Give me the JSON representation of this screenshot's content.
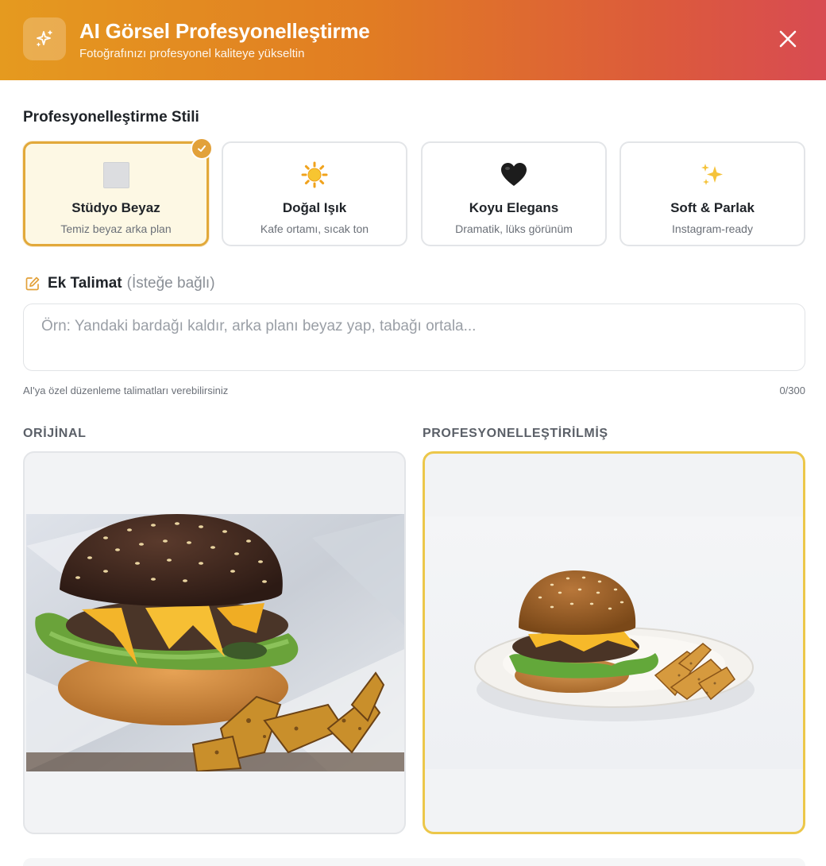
{
  "header": {
    "title": "AI Görsel Profesyonelleştirme",
    "subtitle": "Fotoğrafınızı profesyonel kaliteye yükseltin",
    "icon": "sparkles-icon",
    "close_icon": "close-icon",
    "gradient": [
      "#e59a1f",
      "#d84b52"
    ]
  },
  "style_section": {
    "label": "Profesyonelleştirme Stili",
    "options": [
      {
        "emoji": "⬜",
        "title": "Stüdyo Beyaz",
        "desc": "Temiz beyaz arka plan",
        "selected": true
      },
      {
        "emoji": "☀️",
        "title": "Doğal Işık",
        "desc": "Kafe ortamı, sıcak ton",
        "selected": false
      },
      {
        "emoji": "🖤",
        "title": "Koyu Elegans",
        "desc": "Dramatik, lüks görünüm",
        "selected": false
      },
      {
        "emoji": "✨",
        "title": "Soft & Parlak",
        "desc": "Instagram-ready",
        "selected": false
      }
    ],
    "accent": "#e2a13a"
  },
  "instruction": {
    "title": "Ek Talimat",
    "optional": "(İsteğe bağlı)",
    "placeholder": "Örn: Yandaki bardağı kaldır, arka planı beyaz yap, tabağı ortala...",
    "value": "",
    "hint": "AI'ya özel düzenleme talimatları verebilirsiniz",
    "counter": "0/300"
  },
  "compare": {
    "original_label": "ORİJİNAL",
    "enhanced_label": "PROFESYONELLEŞTİRİLMİŞ"
  }
}
